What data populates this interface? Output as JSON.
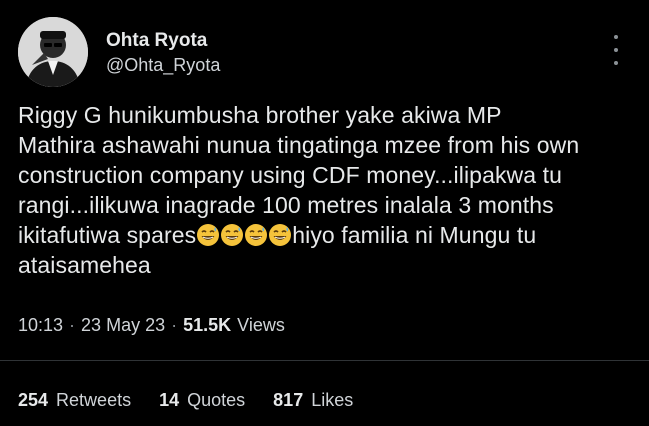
{
  "author": {
    "display_name": "Ohta Ryota",
    "handle": "@Ohta_Ryota"
  },
  "tweet": {
    "line1": "Riggy G hunikumbusha brother yake akiwa MP",
    "line2": "Mathira ashawahi nunua tingatinga mzee from his own",
    "line3": "construction company using CDF money...ilipakwa tu",
    "line4": "rangi...ilikuwa inagrade 100 metres inalala 3 months",
    "line5_before": "ikitafutiwa spares",
    "line5_after": "hiyo familia ni Mungu tu",
    "line6": "ataisamehea",
    "emoji_name": "grinning-sweat-emoji",
    "emoji_count": 4
  },
  "meta": {
    "time": "10:13",
    "separator": "·",
    "date": "23 May 23",
    "views_count": "51.5K",
    "views_label": "Views"
  },
  "stats": {
    "retweets_count": "254",
    "retweets_label": "Retweets",
    "quotes_count": "14",
    "quotes_label": "Quotes",
    "likes_count": "817",
    "likes_label": "Likes"
  },
  "colors": {
    "background": "#000000",
    "primary_text": "#e7e9ea",
    "secondary_text": "#d0d4d8",
    "divider": "#2f3336",
    "emoji_face": "#f5c33b"
  }
}
